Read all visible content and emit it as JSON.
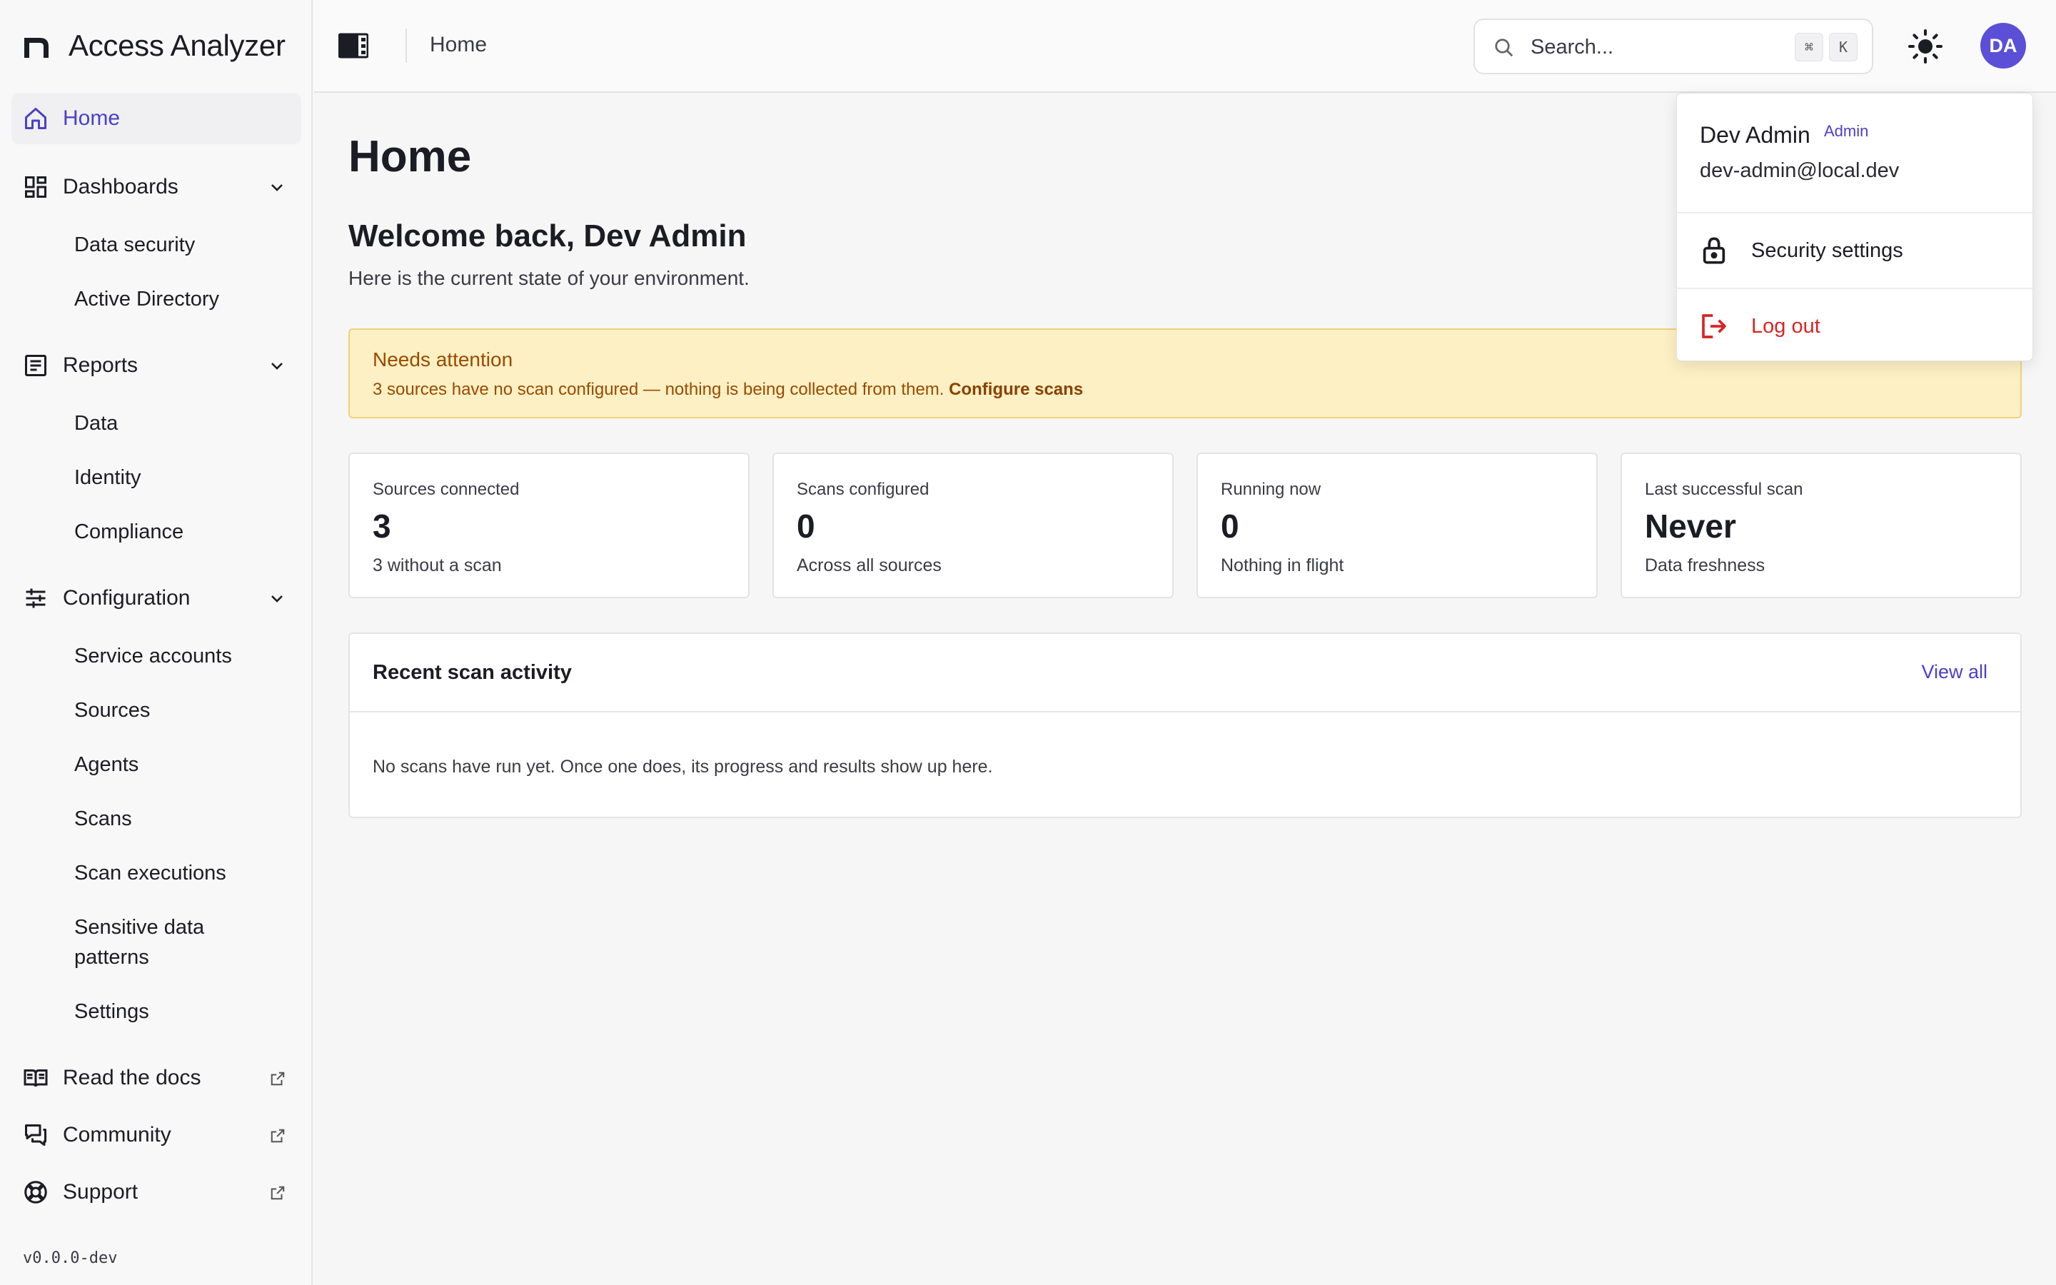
{
  "app": {
    "name": "Access Analyzer",
    "version": "v0.0.0-dev"
  },
  "sidebar": {
    "home": {
      "label": "Home",
      "icon": "home-icon"
    },
    "dashboards": {
      "label": "Dashboards",
      "icon": "dashboard-icon",
      "items": [
        "Data security",
        "Active Directory"
      ]
    },
    "reports": {
      "label": "Reports",
      "icon": "report-icon",
      "items": [
        "Data",
        "Identity",
        "Compliance"
      ]
    },
    "configuration": {
      "label": "Configuration",
      "icon": "sliders-icon",
      "items": [
        "Service accounts",
        "Sources",
        "Agents",
        "Scans",
        "Scan executions",
        "Sensitive data patterns",
        "Settings"
      ]
    },
    "links": [
      {
        "label": "Read the docs",
        "icon": "book-icon"
      },
      {
        "label": "Community",
        "icon": "chat-icon"
      },
      {
        "label": "Support",
        "icon": "lifebuoy-icon"
      }
    ]
  },
  "topbar": {
    "breadcrumb": "Home",
    "search_placeholder": "Search...",
    "shortcut_keys": [
      "⌘",
      "K"
    ],
    "avatar_initials": "DA"
  },
  "main": {
    "title": "Home",
    "welcome": "Welcome back, Dev Admin",
    "subtitle": "Here is the current state of your environment.",
    "alert": {
      "title": "Needs attention",
      "text": "3 sources have no scan configured — nothing is being collected from them.",
      "link": "Configure scans"
    },
    "stats": [
      {
        "label": "Sources connected",
        "value": "3",
        "sub": "3 without a scan"
      },
      {
        "label": "Scans configured",
        "value": "0",
        "sub": "Across all sources"
      },
      {
        "label": "Running now",
        "value": "0",
        "sub": "Nothing in flight"
      },
      {
        "label": "Last successful scan",
        "value": "Never",
        "sub": "Data freshness"
      }
    ],
    "activity": {
      "title": "Recent scan activity",
      "link": "View all",
      "empty": "No scans have run yet. Once one does, its progress and results show up here."
    }
  },
  "user_menu": {
    "name": "Dev Admin",
    "role": "Admin",
    "email": "dev-admin@local.dev",
    "security_label": "Security settings",
    "logout_label": "Log out"
  },
  "colors": {
    "accent": "#4a41c8",
    "avatar": "#5b4fd8",
    "alert_bg": "#fdf0c4",
    "alert_text": "#9a4a00",
    "danger": "#d62626"
  }
}
